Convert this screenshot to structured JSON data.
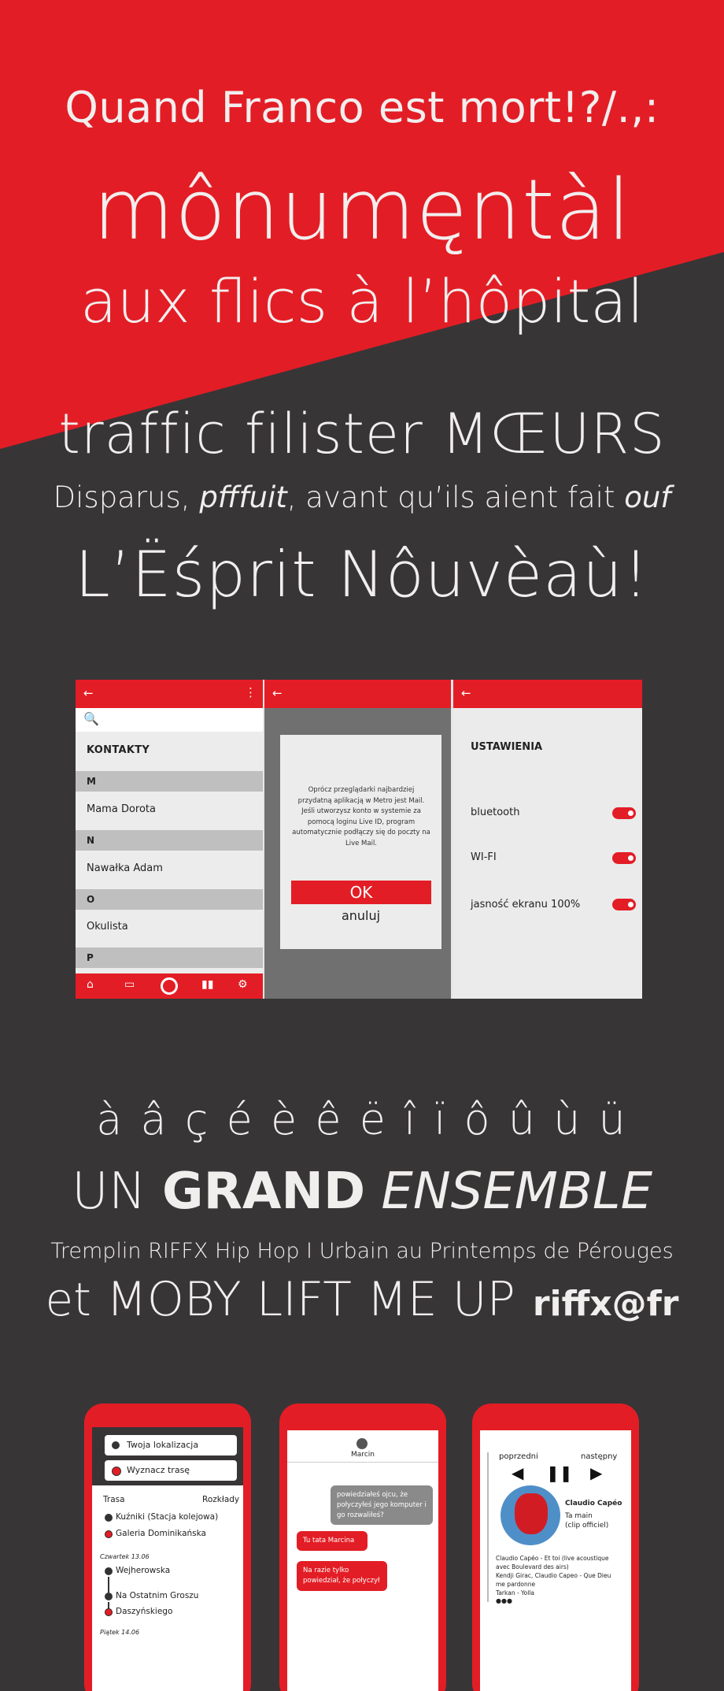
{
  "poster": {
    "line1": "Quand Franco est mort!?/.,:",
    "line2": "mônumęntàl",
    "line3": "aux flics à l’hôpital",
    "line4": "traffic filister MŒURS",
    "line5": {
      "a": "Disparus, ",
      "b": "pfffuit",
      "c": ", avant qu’ils aient fait ",
      "d": "ouf"
    },
    "line6": "L’Ëśprit Nôuvèaù!",
    "line7": "à â ç é è ê ë î ï ô û ù ü",
    "line8": {
      "a": "UN ",
      "b": "GRAND",
      "c": " ",
      "d": "ENSEMBLE"
    },
    "line9": "Tremplin RIFFX Hip Hop I Urbain au Printemps de Pérouges",
    "line10": {
      "a": "et",
      "b": " MOBY LIFT ME UP",
      "c": "riffx@fr"
    },
    "colors": {
      "red": "#e31d25",
      "dark": "#383537",
      "text": "#f1eeee"
    }
  },
  "screen_contacts": {
    "back_icon": "arrow-left-icon",
    "back": "←",
    "menu": "⋮",
    "search_icon": "🔍",
    "title": "KONTAKTY",
    "sections": [
      "M",
      "N",
      "O",
      "P"
    ],
    "contacts": [
      "Mama Dorota",
      "Nawałka Adam",
      "Okulista"
    ]
  },
  "screen_dialog": {
    "back": "←",
    "message": "Oprócz przeglądarki najbardziej przydatną aplikacją w Metro jest Mail. Jeśli utworzysz konto w systemie za pomocą loginu Live ID, program automatycznie podłączy się do poczty na Live Mail.",
    "ok": "OK",
    "cancel": "anuluj"
  },
  "screen_settings": {
    "back": "←",
    "title": "USTAWIENIA",
    "rows": [
      "bluetooth",
      "WI-FI",
      "jasność ekranu 100%"
    ],
    "toggles_on": [
      true,
      true,
      true
    ]
  },
  "phone_map": {
    "location": "Twoja lokalizacja",
    "route": "Wyznacz trasę",
    "tab_route": "Trasa",
    "tab_schedule": "Rozkłady",
    "stop1": "Kuźniki (Stacja kolejowa)",
    "stop2": "Galeria Dominikańska",
    "date1": "Czwartek 13.06",
    "stop3": "Wejherowska",
    "stop4": "Na Ostatnim Groszu",
    "stop5": "Daszyńskiego",
    "date2": "Piątek 14.06"
  },
  "phone_chat": {
    "contact": "Marcin",
    "msg1": "powiedziałeś ojcu, że połyczyłeś jego komputer i go rozwaliłeś?",
    "msg2": "Tu tata Marcina",
    "msg3": "Na razie tylko powiedział, że połyczył"
  },
  "phone_music": {
    "prev": "poprzedni",
    "next": "następny",
    "artist": "Claudio Capéo",
    "track": "Ta main",
    "track_sub": "(clip officiel)",
    "list1": "Claudio Capéo - Et toi (live acoustique avec Boulevard des airs)",
    "list2": "Kendji Girac, Claudio Capeo - Que Dieu me pardonne",
    "list3": "Tarkan - Yolla",
    "more": "●●●"
  }
}
